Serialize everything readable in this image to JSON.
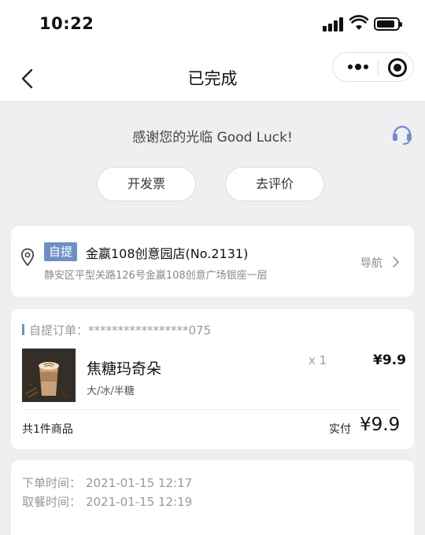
{
  "status_bar": {
    "time": "10:22"
  },
  "nav": {
    "title": "已完成"
  },
  "thanks": {
    "text": "感谢您的光临 Good Luck!"
  },
  "actions": {
    "invoice": "开发票",
    "review": "去评价"
  },
  "store": {
    "tag": "自提",
    "name": "金嬴108创意园店(No.2131)",
    "address": "静安区平型关路126号金嬴108创意广场银座一层",
    "nav_label": "导航"
  },
  "order": {
    "number_label": "自提订单：",
    "number_value": "*****************075",
    "product": {
      "name": "焦糖玛奇朵",
      "spec": "大/冰/半糖",
      "qty": "x 1",
      "price": "¥9.9"
    },
    "total_items": "共1件商品",
    "paid_label": "实付",
    "paid_value": "¥9.9"
  },
  "times": {
    "order_label": "下单时间：",
    "order_value": "2021-01-15 12:17",
    "pickup_label": "取餐时间：",
    "pickup_value": "2021-01-15 12:19"
  },
  "colors": {
    "accent": "#6f8fc7",
    "background": "#efeff1"
  }
}
